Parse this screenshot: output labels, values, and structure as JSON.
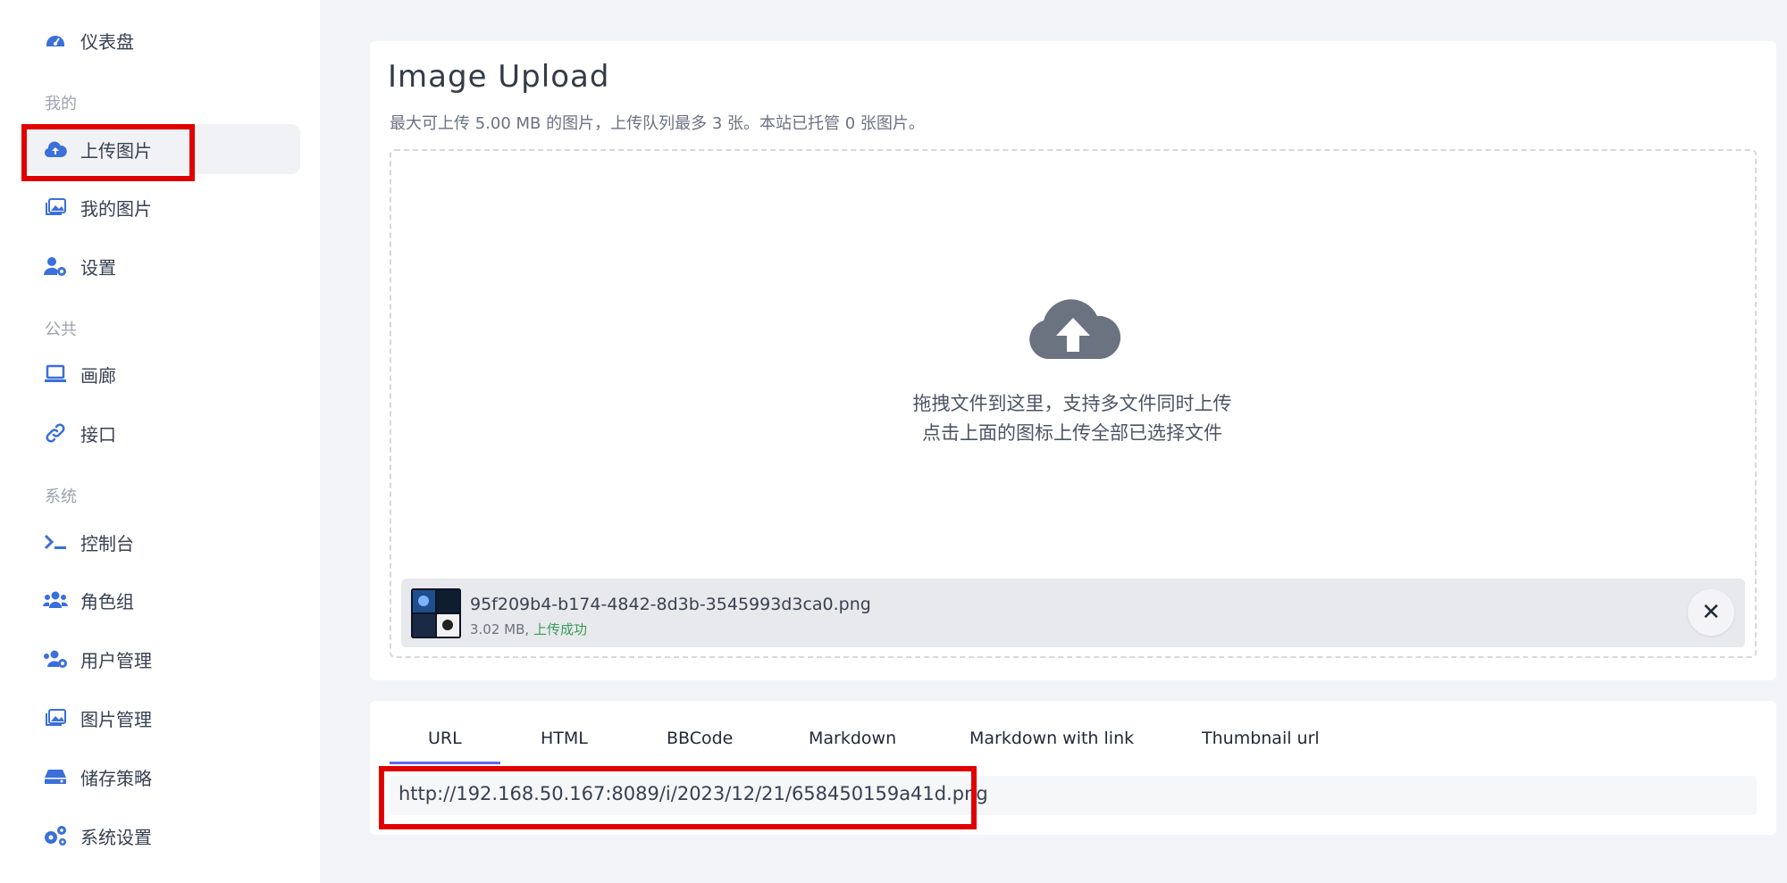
{
  "sidebar": {
    "dashboard": "仪表盘",
    "section_mine": "我的",
    "upload": "上传图片",
    "my_images": "我的图片",
    "settings": "设置",
    "section_public": "公共",
    "gallery": "画廊",
    "api": "接口",
    "section_system": "系统",
    "console": "控制台",
    "roles": "角色组",
    "users": "用户管理",
    "image_mgmt": "图片管理",
    "storage": "储存策略",
    "sys_settings": "系统设置"
  },
  "upload": {
    "title": "Image Upload",
    "subtitle": "最大可上传 5.00 MB 的图片，上传队列最多 3 张。本站已托管 0 张图片。",
    "drop_line1": "拖拽文件到这里，支持多文件同时上传",
    "drop_line2": "点击上面的图标上传全部已选择文件"
  },
  "file": {
    "name": "95f209b4-b174-4842-8d3b-3545993d3ca0.png",
    "size": "3.02 MB,",
    "status": "上传成功",
    "remove": "✕"
  },
  "links": {
    "tabs": [
      "URL",
      "HTML",
      "BBCode",
      "Markdown",
      "Markdown with link",
      "Thumbnail url"
    ],
    "url": "http://192.168.50.167:8089/i/2023/12/21/658450159a41d.png"
  },
  "colors": {
    "accent": "#6366f1",
    "icon_blue": "#3b6fd9",
    "highlight": "#e00000",
    "success": "#3a9c5b"
  }
}
